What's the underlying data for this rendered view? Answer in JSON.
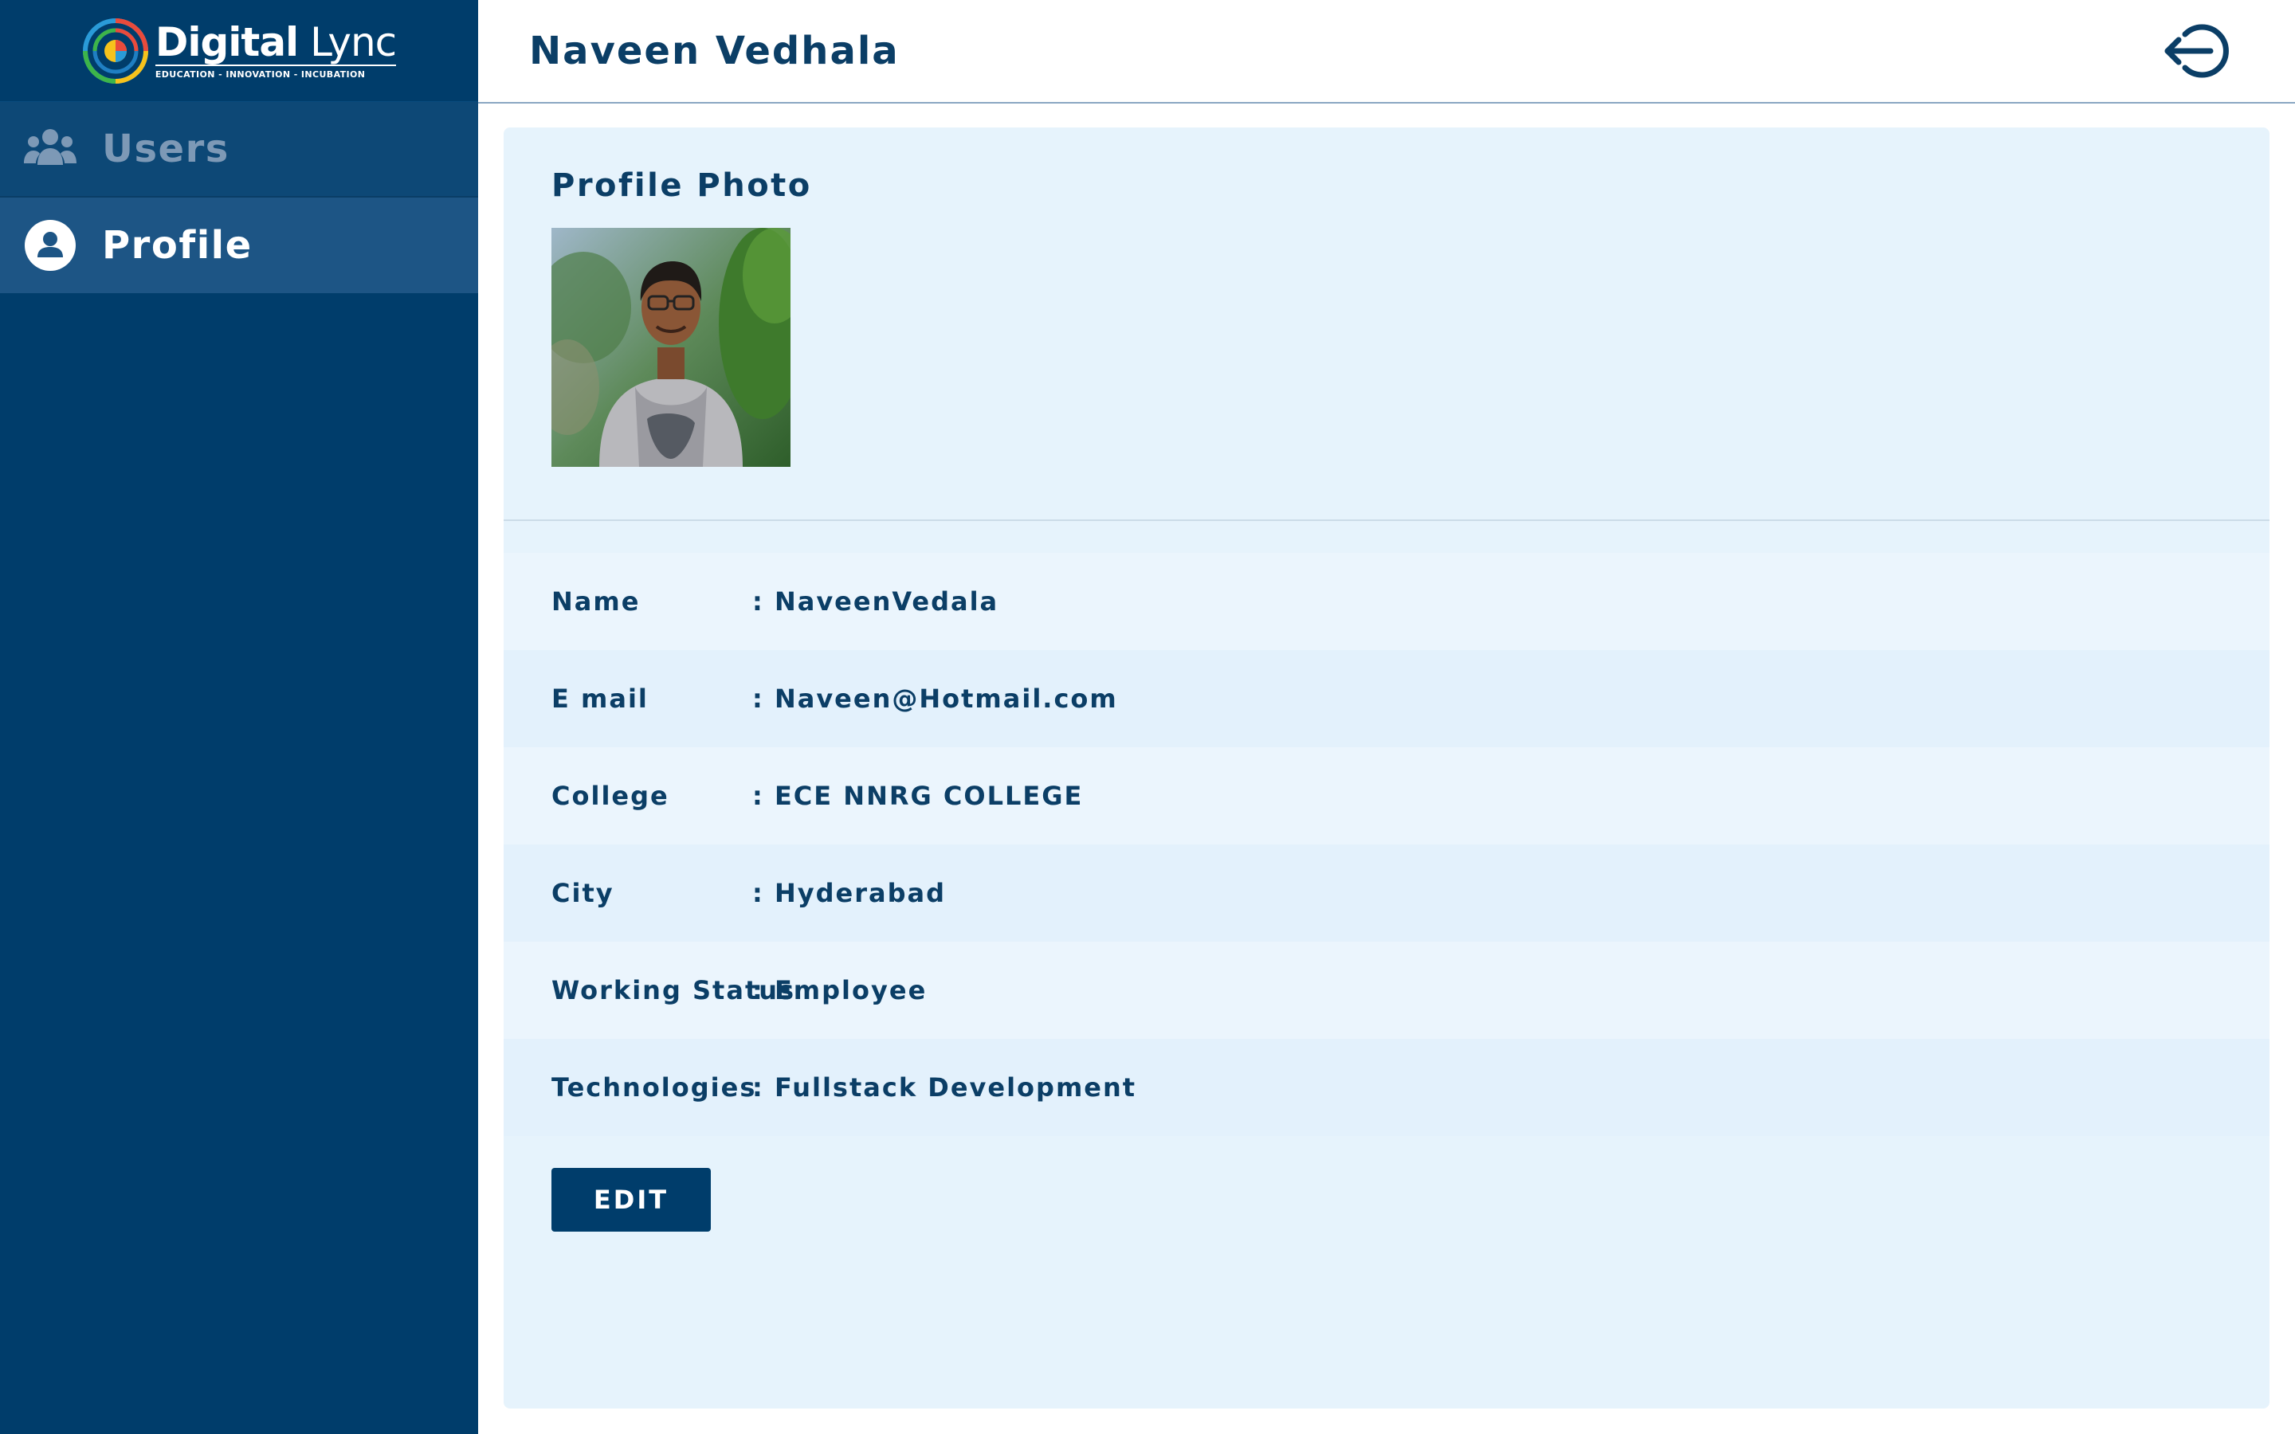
{
  "app": {
    "logo": {
      "name_bold": "Digital",
      "name_light": " Lync",
      "tagline": "EDUCATION - INNOVATION - INCUBATION"
    }
  },
  "sidebar": {
    "items": [
      {
        "label": "Users",
        "icon": "users-group-icon",
        "active": false
      },
      {
        "label": "Profile",
        "icon": "user-circle-icon",
        "active": true
      }
    ]
  },
  "header": {
    "title": "Naveen Vedhala",
    "logout_icon": "logout-icon"
  },
  "profile": {
    "photo_title": "Profile Photo",
    "fields": [
      {
        "label": "Name",
        "value": ": NaveenVedala"
      },
      {
        "label": "E mail",
        "value": ": Naveen@Hotmail.com"
      },
      {
        "label": "College",
        "value": ": ECE NNRG COLLEGE"
      },
      {
        "label": "City",
        "value": ": Hyderabad"
      },
      {
        "label": "Working Status",
        "value": ": Employee"
      },
      {
        "label": "Technologies",
        "value": ": Fullstack Development"
      }
    ],
    "edit_label": "EDIT"
  },
  "colors": {
    "sidebar_bg": "#003d6b",
    "accent": "#0b3e66",
    "card_bg": "#e6f3fc"
  }
}
